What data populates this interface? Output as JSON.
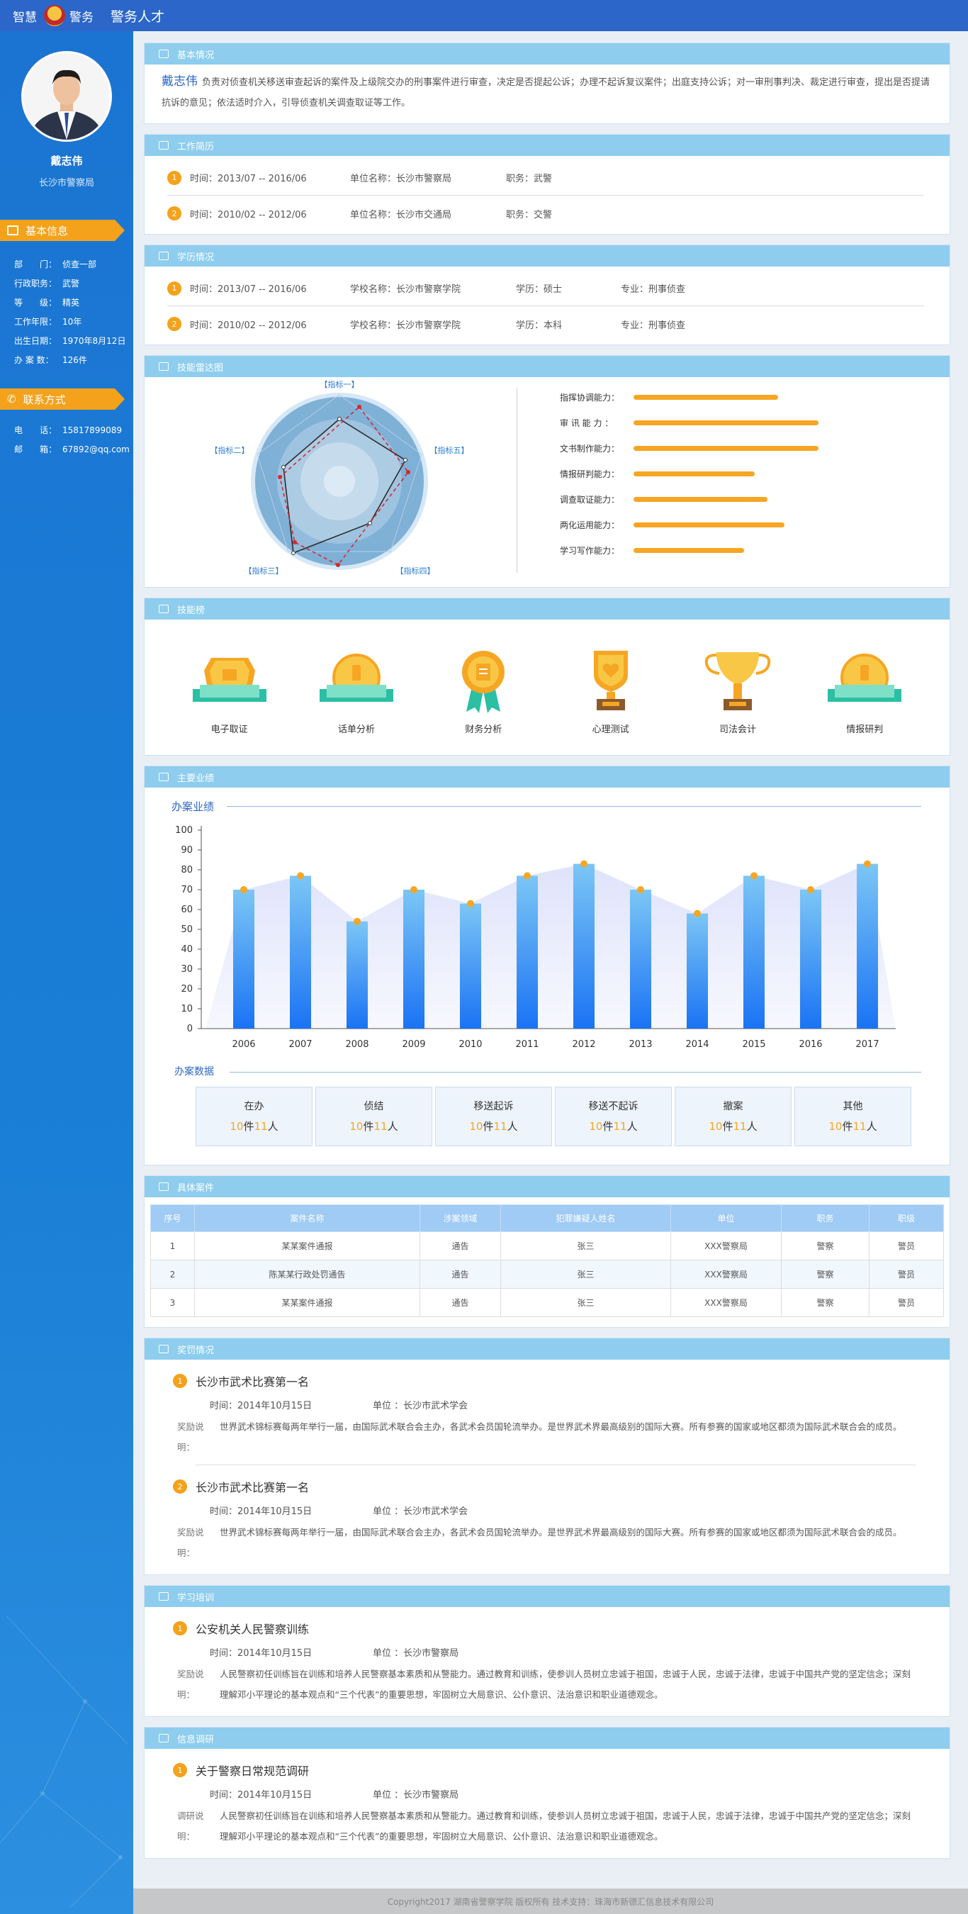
{
  "topbar": {
    "brand_left": "智慧",
    "brand_right": "警务",
    "title": "警务人才"
  },
  "profile": {
    "name": "戴志伟",
    "org": "长沙市警察局"
  },
  "sidebar": {
    "basic_title": "基本信息",
    "basic": [
      {
        "k": "部　　门：",
        "v": "侦查一部"
      },
      {
        "k": "行政职务：",
        "v": "武警"
      },
      {
        "k": "等　　级：",
        "v": "精英"
      },
      {
        "k": "工作年限：",
        "v": "10年"
      },
      {
        "k": "出生日期：",
        "v": "1970年8月12日"
      },
      {
        "k": "办 案 数：",
        "v": "126件"
      }
    ],
    "contact_title": "联系方式",
    "contact": [
      {
        "k": "电　　话：",
        "v": "15817899089"
      },
      {
        "k": "邮　　箱：",
        "v": "67892@qq.com"
      }
    ]
  },
  "basic": {
    "title": "基本情况",
    "name": "戴志伟",
    "text": "负责对侦查机关移送审查起诉的案件及上级院交办的刑事案件进行审查，决定是否提起公诉；办理不起诉复议案件；出庭支持公诉；对一审刑事判决、裁定进行审查，提出是否提请抗诉的意见；依法适时介入，引导侦查机关调查取证等工作。"
  },
  "work": {
    "title": "工作简历",
    "items": [
      {
        "n": "1",
        "time": "时间：2013/07 -- 2016/06",
        "unit": "单位名称：长沙市警察局",
        "role": "职务：武警"
      },
      {
        "n": "2",
        "time": "时间：2010/02 -- 2012/06",
        "unit": "单位名称：长沙市交通局",
        "role": "职务：交警"
      }
    ]
  },
  "edu": {
    "title": "学历情况",
    "items": [
      {
        "n": "1",
        "time": "时间：2013/07 -- 2016/06",
        "school": "学校名称：长沙市警察学院",
        "degree": "学历：硕士",
        "major": "专业：刑事侦查"
      },
      {
        "n": "2",
        "time": "时间：2010/02 -- 2012/06",
        "school": "学校名称：长沙市警察学院",
        "degree": "学历：本科",
        "major": "专业：刑事侦查"
      }
    ]
  },
  "radar": {
    "title": "技能雷达图",
    "labels": [
      "【指标一】",
      "【指标二】",
      "【指标三】",
      "【指标四】",
      "【指标五】"
    ],
    "bars": [
      {
        "label": "指挥协调能力：",
        "value": 0.68
      },
      {
        "label": "审 讯 能 力 ：",
        "value": 0.87
      },
      {
        "label": "文书制作能力：",
        "value": 0.87
      },
      {
        "label": "情报研判能力：",
        "value": 0.57
      },
      {
        "label": "调查取证能力：",
        "value": 0.63
      },
      {
        "label": "两化运用能力：",
        "value": 0.71
      },
      {
        "label": "学习写作能力：",
        "value": 0.52
      }
    ]
  },
  "skillboard": {
    "title": "技能榜",
    "items": [
      {
        "label": "电子取证",
        "icon": "monitor-badge-icon"
      },
      {
        "label": "话单分析",
        "icon": "phone-badge-icon"
      },
      {
        "label": "财务分析",
        "icon": "document-medal-icon"
      },
      {
        "label": "心理测试",
        "icon": "heart-trophy-icon"
      },
      {
        "label": "司法会计",
        "icon": "cup-trophy-icon"
      },
      {
        "label": "情报研判",
        "icon": "phone-badge-icon"
      }
    ]
  },
  "performance": {
    "title": "主要业绩",
    "chart_title": "办案业绩",
    "stats_title": "办案数据",
    "stats": [
      {
        "name": "在办",
        "a": "10",
        "b": "11"
      },
      {
        "name": "侦结",
        "a": "10",
        "b": "11"
      },
      {
        "name": "移送起诉",
        "a": "10",
        "b": "11"
      },
      {
        "name": "移送不起诉",
        "a": "10",
        "b": "11"
      },
      {
        "name": "撤案",
        "a": "10",
        "b": "11"
      },
      {
        "name": "其他",
        "a": "10",
        "b": "11"
      }
    ],
    "unit_a": "件",
    "unit_b": "人"
  },
  "chart_data": {
    "type": "bar",
    "title": "办案业绩",
    "categories": [
      "2006",
      "2007",
      "2008",
      "2009",
      "2010",
      "2011",
      "2012",
      "2013",
      "2014",
      "2015",
      "2016",
      "2017"
    ],
    "values": [
      70,
      77,
      54,
      70,
      63,
      77,
      83,
      70,
      58,
      77,
      70,
      83
    ],
    "ylim": [
      0,
      100
    ],
    "yticks": [
      0,
      10,
      20,
      30,
      40,
      50,
      60,
      70,
      80,
      90,
      100
    ],
    "accent": "#1e7df5",
    "dot": "#f6a623"
  },
  "cases": {
    "title": "具体案件",
    "headers": [
      "序号",
      "案件名称",
      "涉案领域",
      "犯罪嫌疑人姓名",
      "单位",
      "职务",
      "职级"
    ],
    "rows": [
      [
        "1",
        "某某案件通报",
        "通告",
        "张三",
        "XXX警察局",
        "警察",
        "警员"
      ],
      [
        "2",
        "陈某某行政处罚通告",
        "通告",
        "张三",
        "XXX警察局",
        "警察",
        "警员"
      ],
      [
        "3",
        "某某案件通报",
        "通告",
        "张三",
        "XXX警察局",
        "警察",
        "警员"
      ]
    ]
  },
  "rewards": {
    "title": "奖罚情况",
    "items": [
      {
        "n": "1",
        "title": "长沙市武术比赛第一名",
        "time": "时间：2014年10月15日",
        "unit": "单位 ：长沙市武术学会",
        "k": "奖励说明：",
        "desc": "世界武术锦标赛每两年举行一届，由国际武术联合会主办，各武术会员国轮流举办。是世界武术界最高级别的国际大赛。所有参赛的国家或地区都须为国际武术联合会的成员。"
      },
      {
        "n": "2",
        "title": "长沙市武术比赛第一名",
        "time": "时间：2014年10月15日",
        "unit": "单位 ：长沙市武术学会",
        "k": "奖励说明：",
        "desc": "世界武术锦标赛每两年举行一届，由国际武术联合会主办，各武术会员国轮流举办。是世界武术界最高级别的国际大赛。所有参赛的国家或地区都须为国际武术联合会的成员。"
      }
    ]
  },
  "training": {
    "title": "学习培训",
    "items": [
      {
        "n": "1",
        "title": "公安机关人民警察训练",
        "time": "时间：2014年10月15日",
        "unit": "单位 ：长沙市警察局",
        "k": "奖励说明：",
        "desc": "人民警察初任训练旨在训练和培养人民警察基本素质和从警能力。通过教育和训练，使参训人员树立忠诚于祖国，忠诚于人民，忠诚于法律，忠诚于中国共产党的坚定信念；深刻理解邓小平理论的基本观点和“三个代表”的重要思想，牢固树立大局意识、公仆意识、法治意识和职业道德观念。"
      }
    ]
  },
  "research": {
    "title": "信息调研",
    "items": [
      {
        "n": "1",
        "title": "关于警察日常规范调研",
        "time": "时间：2014年10月15日",
        "unit": "单位 ：长沙市警察局",
        "k": "调研说明：",
        "desc": "人民警察初任训练旨在训练和培养人民警察基本素质和从警能力。通过教育和训练，使参训人员树立忠诚于祖国，忠诚于人民，忠诚于法律，忠诚于中国共产党的坚定信念；深刻理解邓小平理论的基本观点和“三个代表”的重要思想，牢固树立大局意识、公仆意识、法治意识和职业道德观念。"
      }
    ]
  },
  "footer": {
    "text": "Copyright2017  湖南省警察学院  版权所有     技术支持：珠海市新德汇信息技术有限公司"
  }
}
